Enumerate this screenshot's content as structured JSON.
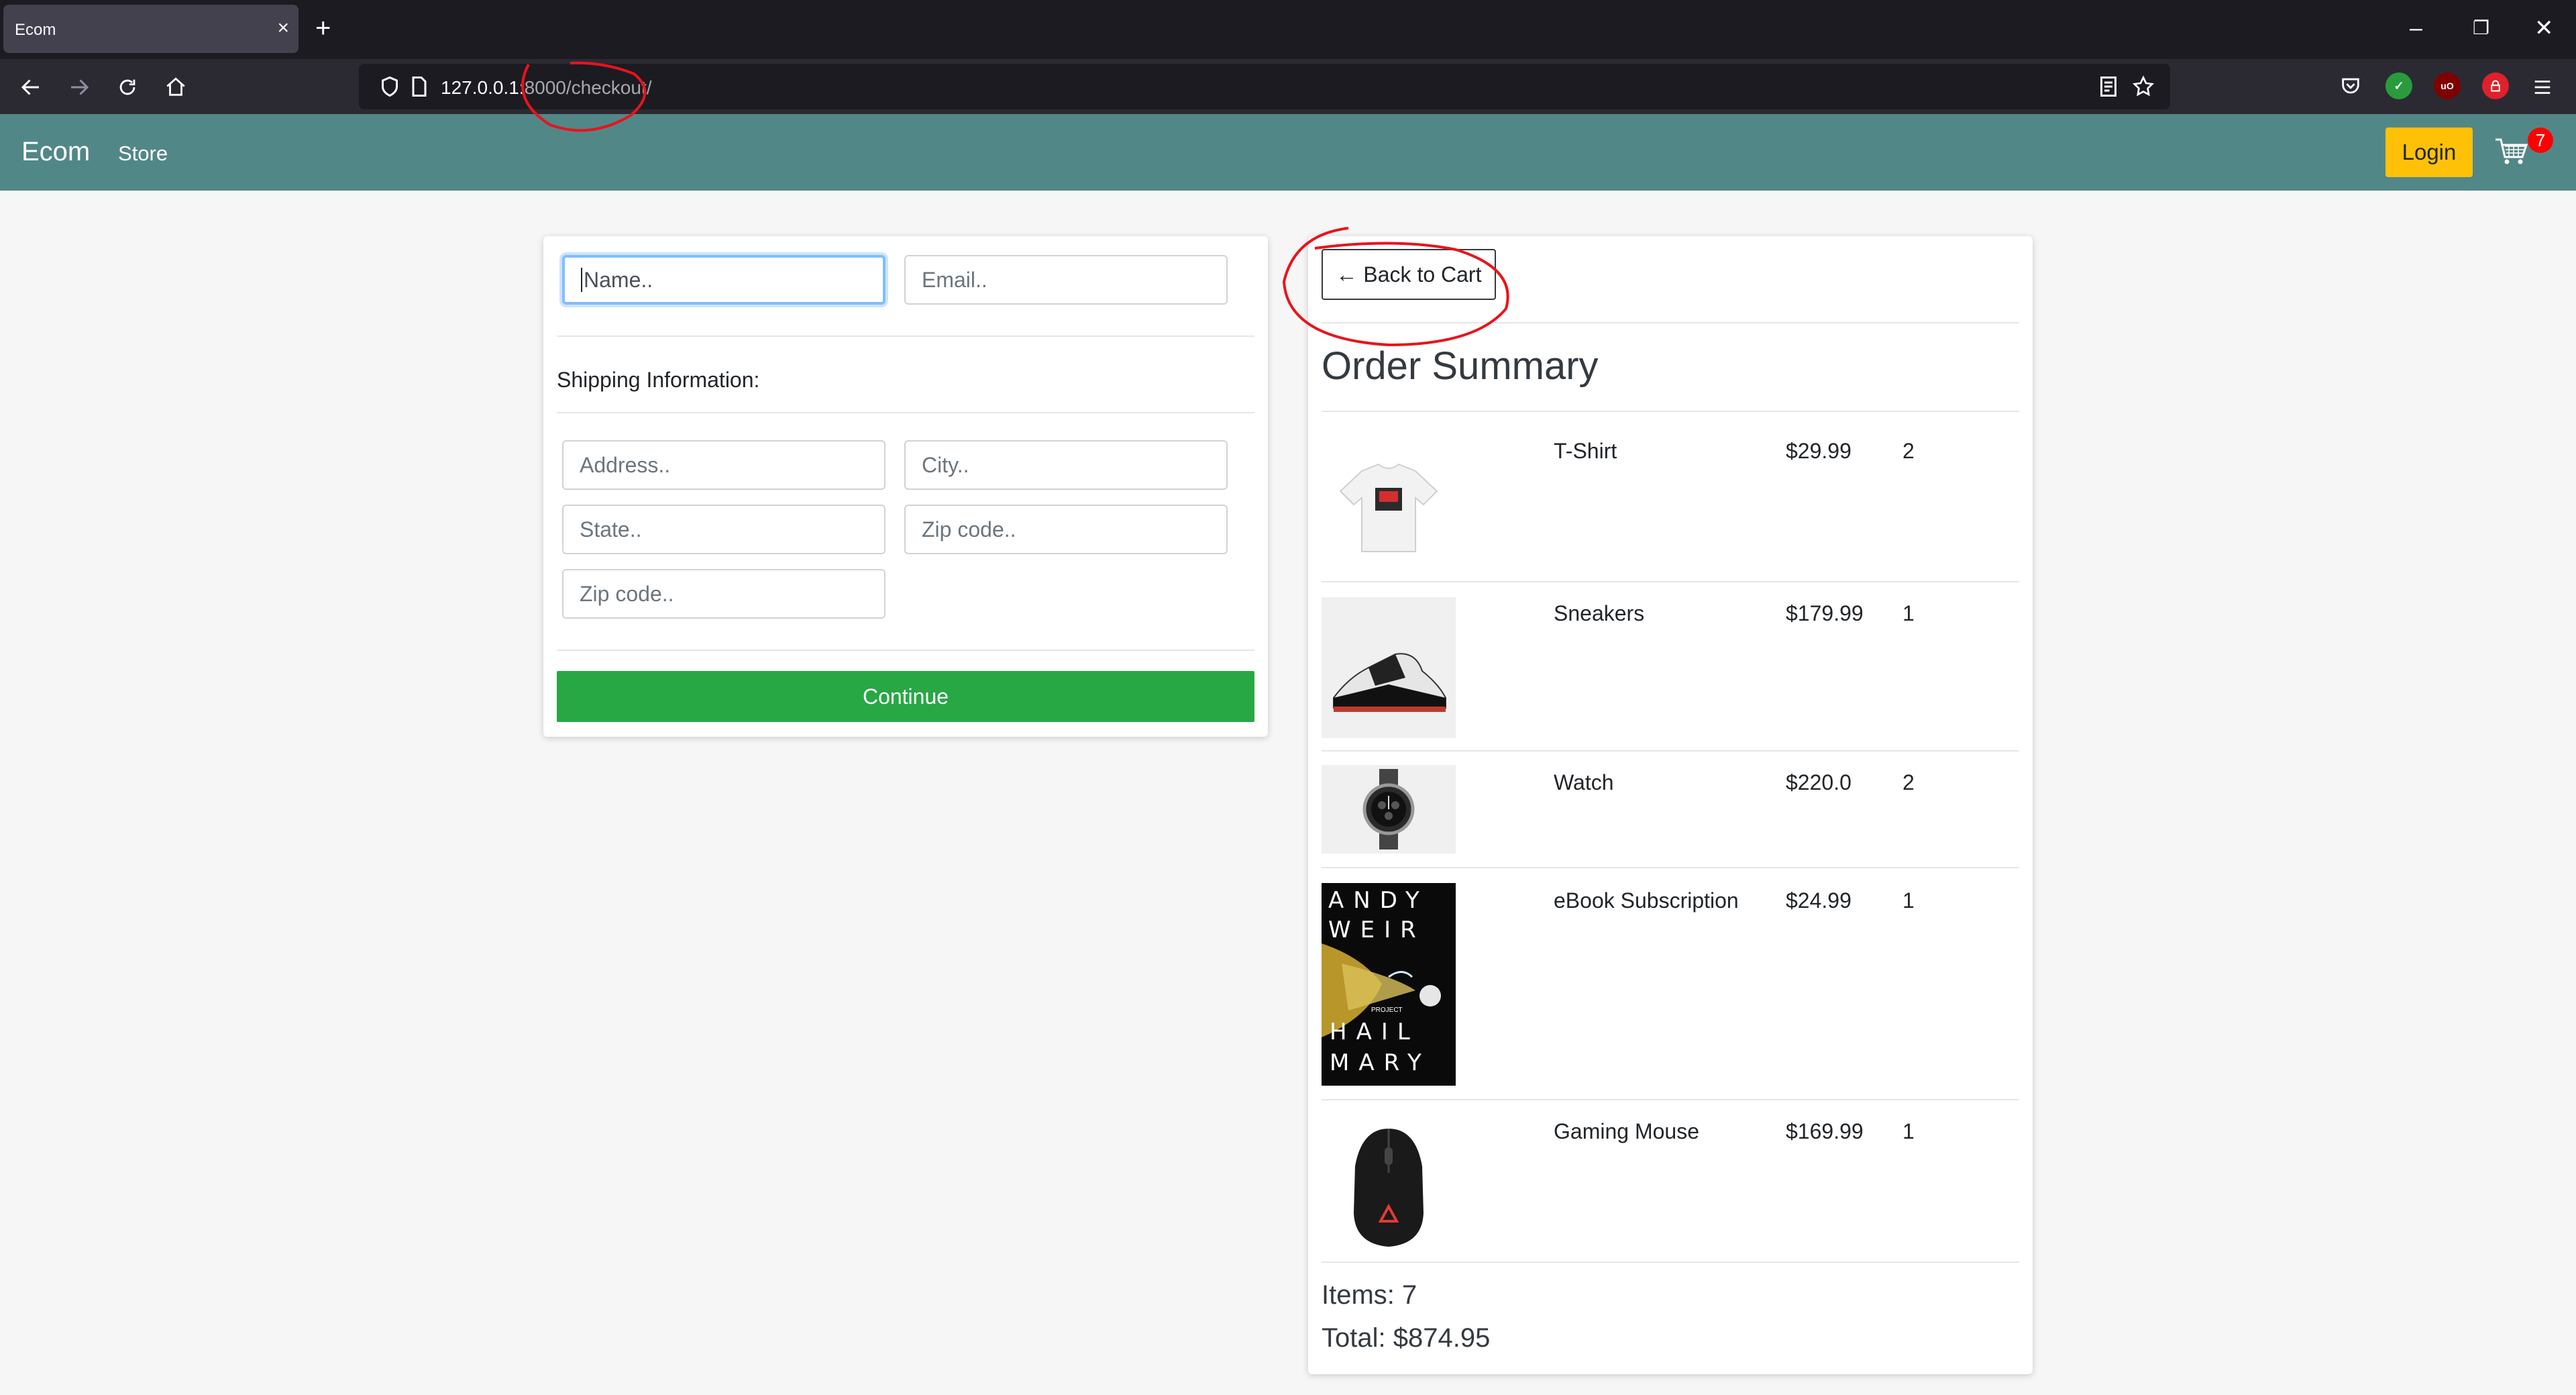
{
  "browser": {
    "tab_title": "Ecom",
    "tab_close": "×",
    "new_tab": "+",
    "url_host": "127.0.0.1:",
    "url_rest": "8000/checkout/",
    "win_min": "–",
    "win_restore": "❐",
    "win_close": "✕"
  },
  "header": {
    "brand": "Ecom",
    "store_link": "Store",
    "login_label": "Login",
    "cart_count": "7"
  },
  "form": {
    "name_placeholder": "Name..",
    "email_placeholder": "Email..",
    "shipping_label": "Shipping Information:",
    "address_placeholder": "Address..",
    "city_placeholder": "City..",
    "state_placeholder": "State..",
    "zip_placeholder": "Zip code..",
    "zip2_placeholder": "Zip code..",
    "continue_label": "Continue"
  },
  "summary": {
    "back_label": "← Back to Cart",
    "title": "Order Summary",
    "items": [
      {
        "name": "T-Shirt",
        "price": "$29.99",
        "qty": "2"
      },
      {
        "name": "Sneakers",
        "price": "$179.99",
        "qty": "1"
      },
      {
        "name": "Watch",
        "price": "$220.0",
        "qty": "2"
      },
      {
        "name": "eBook Subscription",
        "price": "$24.99",
        "qty": "1"
      },
      {
        "name": "Gaming Mouse",
        "price": "$169.99",
        "qty": "1"
      }
    ],
    "book_cover": [
      "ANDY",
      "WEIR",
      "PROJECT",
      "HAIL",
      "MARY"
    ],
    "items_count": "Items: 7",
    "total": "Total: $874.95"
  },
  "colors": {
    "site_nav": "#528788",
    "login": "#ffc107",
    "continue": "#28a745",
    "annotation": "#e8141b"
  }
}
